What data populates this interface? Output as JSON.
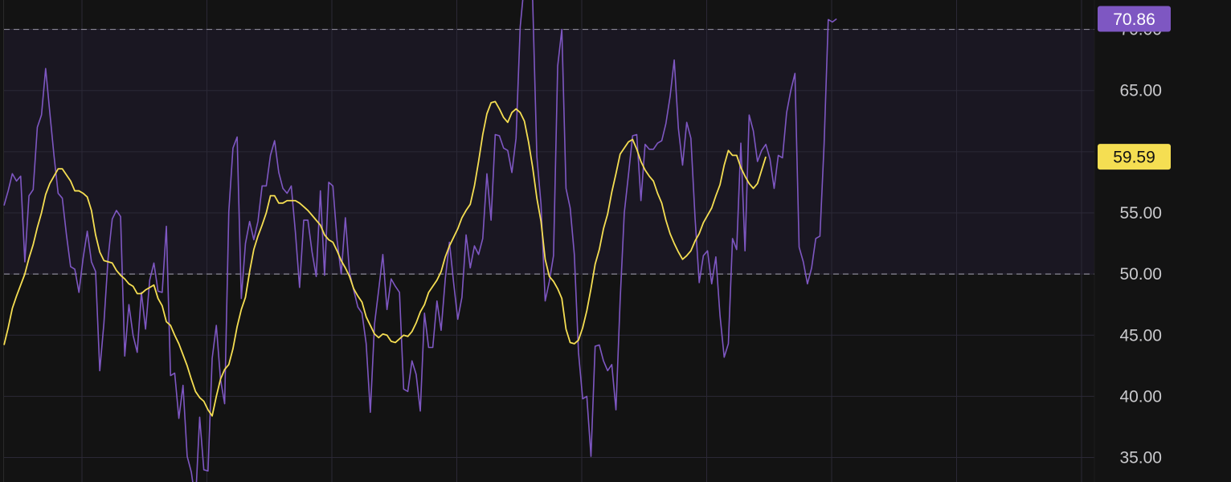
{
  "chart_data": {
    "type": "line",
    "title": "",
    "xlabel": "",
    "ylabel": "",
    "ylim": [
      33.0,
      72.4
    ],
    "yticks": [
      "35.00",
      "40.00",
      "45.00",
      "50.00",
      "55.00",
      "60.00",
      "65.00",
      "70.00"
    ],
    "reference_lines": [
      70,
      50
    ],
    "grid": true,
    "legend": "none",
    "x": [
      0,
      1,
      2,
      3,
      4,
      5,
      6,
      7,
      8,
      9,
      10,
      11,
      12,
      13,
      14,
      15,
      16,
      17,
      18,
      19,
      20,
      21,
      22,
      23,
      24,
      25,
      26,
      27,
      28,
      29,
      30,
      31,
      32,
      33,
      34,
      35,
      36,
      37,
      38,
      39,
      40,
      41,
      42,
      43,
      44,
      45,
      46,
      47,
      48,
      49,
      50,
      51,
      52,
      53,
      54,
      55,
      56,
      57,
      58,
      59,
      60,
      61,
      62,
      63,
      64,
      65,
      66,
      67,
      68,
      69,
      70,
      71,
      72,
      73,
      74,
      75,
      76,
      77,
      78,
      79,
      80,
      81,
      82,
      83,
      84,
      85,
      86,
      87,
      88,
      89,
      90,
      91,
      92,
      93,
      94,
      95,
      96,
      97,
      98,
      99,
      100,
      101,
      102,
      103,
      104,
      105,
      106,
      107,
      108,
      109,
      110,
      111,
      112,
      113,
      114,
      115,
      116,
      117,
      118,
      119,
      120,
      121,
      122,
      123,
      124,
      125,
      126,
      127,
      128,
      129,
      130,
      131,
      132,
      133,
      134,
      135,
      136,
      137,
      138,
      139,
      140,
      141,
      142,
      143,
      144,
      145,
      146,
      147,
      148,
      149,
      150,
      151,
      152,
      153,
      154,
      155,
      156,
      157,
      158,
      159,
      160,
      161,
      162,
      163,
      164,
      165,
      166,
      167,
      168,
      169,
      170,
      171,
      172,
      173,
      174,
      175,
      176,
      177,
      178,
      179,
      180,
      181,
      182,
      183,
      184,
      185,
      186,
      187,
      188,
      189,
      190,
      191,
      192,
      193,
      194,
      195,
      196,
      197,
      198,
      199,
      200,
      201,
      202,
      203,
      204,
      205,
      206,
      207,
      208,
      209,
      210,
      211,
      212,
      213,
      214,
      215,
      216,
      217,
      218,
      219,
      220,
      221,
      222,
      223,
      224,
      225,
      226,
      227,
      228,
      229,
      230,
      231,
      232,
      233,
      234,
      235,
      236,
      237,
      238,
      239,
      240,
      241,
      242,
      243,
      244,
      245,
      246,
      247,
      248,
      249
    ],
    "series": [
      {
        "color": "#7e57c2",
        "values": [
          55.6,
          56.8,
          58.2,
          57.6,
          58.0,
          51.0,
          56.4,
          56.9,
          62.0,
          63.0,
          66.8,
          63.2,
          59.7,
          56.6,
          56.2,
          53.2,
          50.6,
          50.4,
          48.5,
          51.3,
          53.5,
          51.0,
          50.2,
          42.1,
          46.0,
          51.3,
          54.5,
          55.2,
          54.7,
          43.3,
          47.5,
          45.0,
          43.6,
          48.5,
          45.5,
          49.5,
          50.9,
          48.6,
          48.5,
          53.9,
          41.7,
          41.9,
          38.2,
          40.9,
          35.1,
          33.8,
          31.4,
          38.3,
          34.0,
          33.9,
          43.1,
          45.8,
          41.4,
          39.4,
          55.1,
          60.3,
          61.2,
          48.0,
          52.5,
          54.3,
          52.8,
          54.3,
          57.2,
          57.2,
          59.7,
          60.9,
          58.3,
          57.0,
          56.6,
          57.2,
          53.4,
          48.9,
          54.4,
          54.4,
          51.8,
          49.8,
          56.8,
          49.9,
          57.5,
          57.2,
          52.8,
          50.0,
          54.6,
          50.1,
          48.7,
          47.3,
          46.8,
          44.3,
          38.7,
          45.9,
          48.7,
          51.6,
          47.1,
          49.6,
          49.0,
          48.5,
          40.6,
          40.4,
          42.9,
          41.8,
          38.8,
          46.8,
          44.0,
          44.0,
          47.8,
          45.4,
          49.6,
          52.6,
          49.3,
          46.3,
          48.1,
          53.2,
          50.5,
          52.3,
          51.6,
          52.9,
          58.2,
          54.4,
          61.4,
          61.3,
          60.3,
          60.1,
          58.3,
          61.1,
          70.2,
          73.8,
          78.2,
          72.3,
          59.6,
          55.7,
          47.8,
          49.4,
          51.5,
          67.0,
          70.0,
          57.0,
          55.4,
          51.6,
          43.6,
          39.8,
          40.0,
          35.1,
          44.1,
          44.2,
          42.9,
          42.1,
          42.6,
          38.9,
          47.8,
          55.0,
          58.1,
          61.3,
          61.4,
          56.0,
          60.6,
          60.2,
          60.2,
          60.7,
          60.9,
          62.3,
          64.5,
          67.5,
          61.9,
          58.9,
          62.4,
          61.1,
          54.6,
          49.3,
          51.5,
          51.9,
          49.2,
          51.4,
          46.6,
          43.2,
          44.3,
          52.9,
          52.0,
          60.7,
          51.9,
          63.0,
          61.7,
          59.2,
          60.1,
          60.6,
          59.4,
          57.0,
          59.7,
          59.5,
          63.2,
          65.0,
          66.4,
          52.2,
          51.0,
          49.2,
          50.5,
          52.9,
          53.1,
          60.6,
          70.8,
          70.6,
          70.86
        ]
      },
      {
        "color": "#f5de52",
        "values": [
          44.2,
          45.6,
          47.2,
          48.2,
          49.1,
          50.0,
          51.3,
          52.4,
          53.8,
          55.0,
          56.5,
          57.4,
          58.0,
          58.6,
          58.6,
          58.1,
          57.6,
          56.8,
          56.8,
          56.6,
          56.3,
          55.2,
          53.2,
          51.8,
          51.1,
          51.0,
          50.9,
          50.3,
          49.9,
          49.6,
          49.2,
          49.0,
          48.4,
          48.4,
          48.7,
          48.9,
          49.1,
          48.0,
          47.4,
          46.1,
          45.8,
          45.0,
          44.3,
          43.4,
          42.5,
          41.4,
          40.4,
          39.9,
          39.6,
          38.9,
          38.4,
          40.0,
          41.4,
          42.2,
          42.6,
          43.9,
          45.7,
          47.1,
          48.1,
          50.2,
          52.0,
          53.1,
          54.0,
          55.0,
          56.4,
          56.4,
          55.8,
          55.8,
          56.0,
          56.0,
          56.0,
          55.8,
          55.5,
          55.2,
          54.8,
          54.4,
          54.0,
          53.2,
          52.8,
          52.6,
          51.9,
          51.1,
          50.5,
          49.8,
          48.8,
          48.2,
          47.7,
          46.5,
          45.8,
          45.1,
          44.8,
          45.1,
          45.0,
          44.5,
          44.4,
          44.7,
          45.0,
          44.9,
          45.3,
          46.0,
          46.9,
          47.5,
          48.5,
          49.0,
          49.5,
          50.2,
          51.4,
          52.3,
          53.0,
          53.7,
          54.6,
          55.2,
          55.7,
          57.2,
          59.2,
          61.4,
          63.1,
          64.0,
          64.1,
          63.5,
          62.8,
          62.4,
          63.2,
          63.5,
          63.2,
          62.5,
          60.8,
          58.7,
          56.2,
          54.3,
          51.2,
          49.8,
          49.4,
          48.8,
          48.0,
          45.5,
          44.4,
          44.3,
          44.6,
          45.6,
          47.0,
          48.8,
          50.8,
          52.0,
          53.7,
          54.9,
          56.7,
          58.2,
          59.8,
          60.3,
          60.8,
          61.0,
          60.2,
          59.2,
          58.5,
          58.0,
          57.6,
          56.6,
          55.8,
          54.4,
          53.3,
          52.5,
          51.8,
          51.2,
          51.5,
          51.9,
          52.7,
          53.3,
          54.2,
          54.8,
          55.4,
          56.4,
          57.3,
          58.9,
          60.1,
          59.7,
          59.7,
          58.7,
          58.0,
          57.4,
          57.0,
          57.4,
          58.5,
          59.59
        ]
      }
    ]
  },
  "badges": [
    {
      "text": "70.86",
      "background": "#7e57c2",
      "foreground": "#ffffff",
      "value": 70.86
    },
    {
      "text": "59.59",
      "background": "#f5de52",
      "foreground": "#131313",
      "value": 59.59
    }
  ],
  "colors": {
    "background": "#131313",
    "plot_background": "#1a1722",
    "grid": "#2b2836",
    "reference_line": "#8a8796",
    "axis_text": "#c9c9cc"
  }
}
